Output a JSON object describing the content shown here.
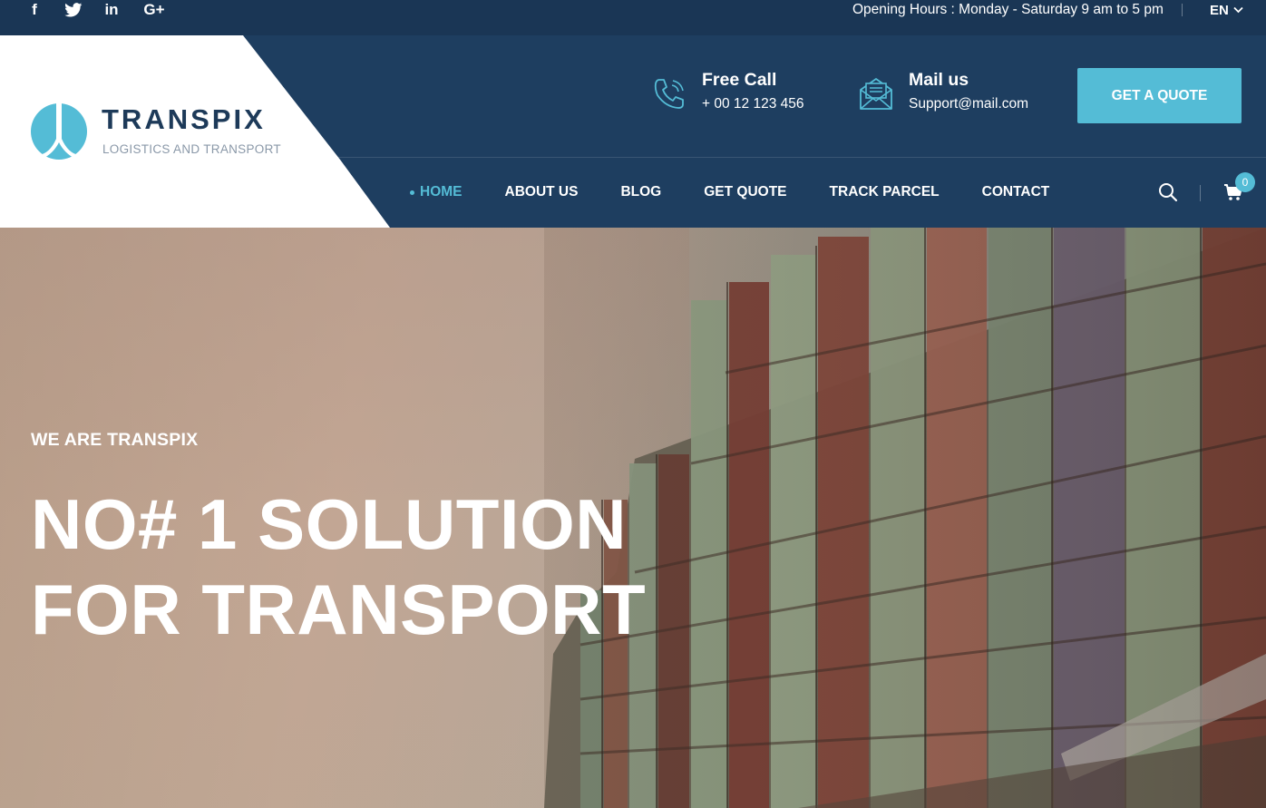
{
  "topbar": {
    "social": [
      {
        "name": "facebook-icon",
        "glyph": "f"
      },
      {
        "name": "twitter-icon",
        "glyph": "🐦"
      },
      {
        "name": "linkedin-icon",
        "glyph": "in"
      },
      {
        "name": "google-plus-icon",
        "glyph": "G+"
      }
    ],
    "hours": "Opening Hours : Monday - Saturday 9 am to 5 pm",
    "language": "EN"
  },
  "brand": {
    "name": "TRANSPIX",
    "tagline": "LOGISTICS AND TRANSPORT"
  },
  "contacts": {
    "call": {
      "title": "Free Call",
      "value": "+ 00 12 123 456",
      "icon": "phone-icon"
    },
    "mail": {
      "title": "Mail us",
      "value": "Support@mail.com",
      "icon": "mail-icon"
    }
  },
  "quote_button": "GET A QUOTE",
  "nav": {
    "items": [
      "HOME",
      "ABOUT US",
      "BLOG",
      "GET QUOTE",
      "TRACK PARCEL",
      "CONTACT"
    ],
    "active": "HOME"
  },
  "cart": {
    "count": "0"
  },
  "hero": {
    "subtitle": "WE ARE TRANSPIX",
    "title_line1": "NO# 1 SOLUTION",
    "title_line2": "FOR TRANSPORT"
  },
  "colors": {
    "topbar": "#1a3655",
    "header": "#1e3e60",
    "accent": "#54bcd6",
    "brand_text": "#1d3a59"
  }
}
